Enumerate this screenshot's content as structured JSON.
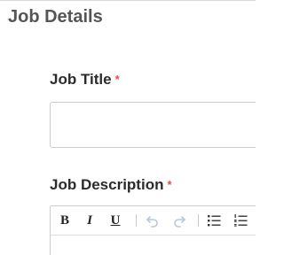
{
  "section": {
    "title": "Job Details"
  },
  "fields": {
    "job_title": {
      "label": "Job Title",
      "required_marker": "*",
      "value": "",
      "placeholder": ""
    },
    "job_description": {
      "label": "Job Description",
      "required_marker": "*"
    }
  },
  "editor_toolbar": {
    "bold": "B",
    "italic": "I",
    "underline": "U",
    "icons": [
      "undo-icon",
      "redo-icon",
      "bulleted-list-icon",
      "numbered-list-icon"
    ]
  },
  "colors": {
    "title": "#555555",
    "label": "#2b2b2b",
    "required": "#d9534f",
    "border": "#cccccc",
    "disabled_icon": "#b9c7dc"
  }
}
